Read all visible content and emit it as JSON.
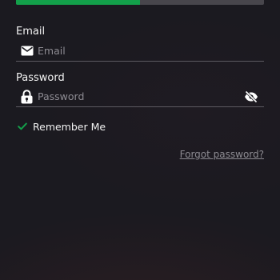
{
  "progress": {
    "fraction": 0.5,
    "fill_color": "#13a04a",
    "track_color": "#48464c"
  },
  "email": {
    "label": "Email",
    "placeholder": "Email",
    "value": "",
    "icon": "envelope-icon"
  },
  "password": {
    "label": "Password",
    "placeholder": "Password",
    "value": "",
    "icon": "lock-icon",
    "toggle_icon": "eye-off-icon"
  },
  "remember": {
    "label": "Remember Me",
    "checked": true,
    "check_color": "#13a04a"
  },
  "forgot": {
    "label": "Forgot password?"
  }
}
